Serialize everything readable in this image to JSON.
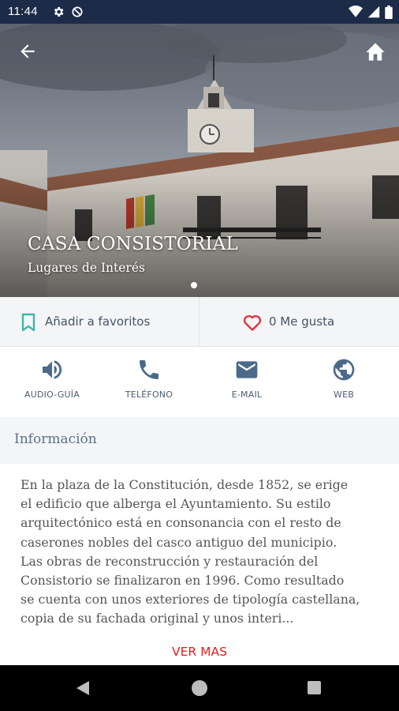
{
  "status_bar": {
    "time": "11:44",
    "left_icons": [
      "settings-icon",
      "data-saver-icon"
    ],
    "right_icons": [
      "wifi-icon",
      "signal-icon",
      "battery-icon"
    ]
  },
  "header": {
    "back_icon": "arrow-back-icon",
    "home_icon": "home-icon",
    "title": "CASA CONSISTORIAL",
    "subtitle": "Lugares de Interés",
    "carousel": {
      "pages": 1,
      "active": 1
    }
  },
  "favorites": {
    "add_label": "Añadir a favoritos",
    "like_label": "0 Me gusta",
    "bookmark_color": "#3fb6a8",
    "heart_color": "#e0303a"
  },
  "actions": [
    {
      "label": "AUDIO-GUÍA",
      "icon": "volume-icon"
    },
    {
      "label": "TELÉFONO",
      "icon": "phone-icon"
    },
    {
      "label": "E-MAIL",
      "icon": "email-icon"
    },
    {
      "label": "WEB",
      "icon": "globe-icon"
    }
  ],
  "info": {
    "title": "Información",
    "lines": [
      "En la plaza de la Constitución, desde 1852, se erige",
      "el edificio que alberga el Ayuntamiento. Su estilo",
      "arquitectónico está en consonancia con el resto de",
      "caserones nobles del casco antiguo del municipio.",
      "Las obras de reconstrucción y restauración del",
      "Consistorio se finalizaron en 1996. Como resultado",
      "se cuenta con unos exteriores de tipología castellana,",
      "copia de su fachada original y unos interi..."
    ],
    "more_label": "VER MAS"
  },
  "colors": {
    "status_bar": "#1c2b47",
    "accent_red": "#e02020",
    "icon_blue": "#4b6a8a",
    "panel_bg": "#f4f5f7"
  }
}
